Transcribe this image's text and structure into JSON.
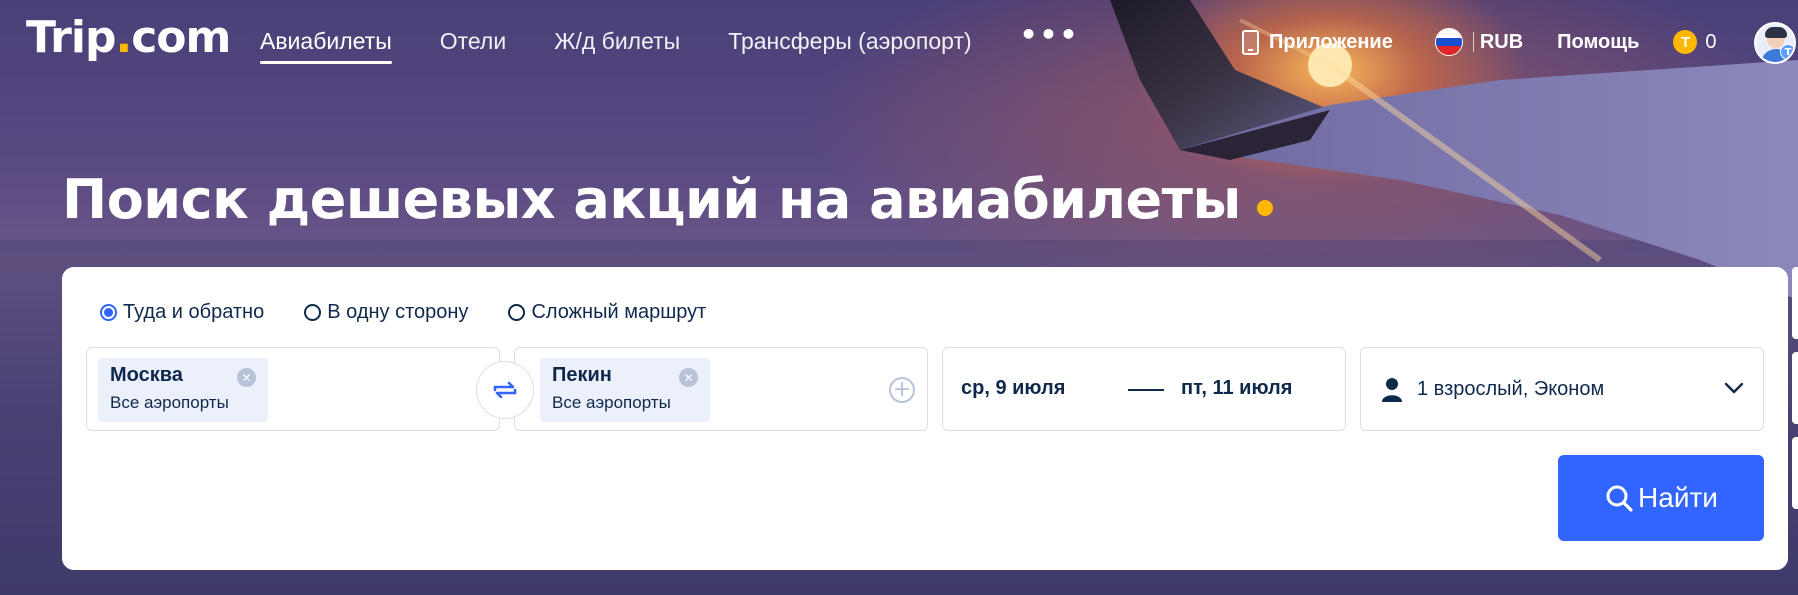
{
  "header": {
    "logo_main": "Trip",
    "logo_dot": ".",
    "logo_suffix": "com",
    "nav": [
      {
        "label": "Авиабилеты",
        "active": true
      },
      {
        "label": "Отели"
      },
      {
        "label": "Ж/д билеты"
      },
      {
        "label": "Трансферы (аэропорт)"
      }
    ],
    "more_label": "•••",
    "app_label": "Приложение",
    "currency": "RUB",
    "help": "Помощь",
    "coins": "0",
    "coin_letter": "T",
    "avatar_badge": "T"
  },
  "hero": {
    "title": "Поиск дешевых акций на авиабилеты"
  },
  "search": {
    "trip_types": [
      {
        "label": "Туда и обратно",
        "checked": true
      },
      {
        "label": "В одну сторону",
        "checked": false
      },
      {
        "label": "Сложный маршрут",
        "checked": false
      }
    ],
    "from": {
      "city": "Москва",
      "sub": "Все аэропорты"
    },
    "to": {
      "city": "Пекин",
      "sub": "Все аэропорты"
    },
    "depart_date": "ср, 9 июля",
    "return_date": "пт, 11 июля",
    "passengers": "1 взрослый, Эконом",
    "search_button": "Найти"
  },
  "icons": {
    "swap": "swap-arrows-icon",
    "add": "plus-circle-icon",
    "clear": "close-circle-icon",
    "person": "person-icon",
    "chevron": "chevron-down-icon",
    "search": "search-icon",
    "phone": "phone-icon",
    "flag": "flag-ru-icon",
    "coin": "coin-icon"
  },
  "colors": {
    "brand_blue": "#3264ff",
    "accent_yellow": "#ffb800",
    "text_dark": "#0f294d"
  }
}
